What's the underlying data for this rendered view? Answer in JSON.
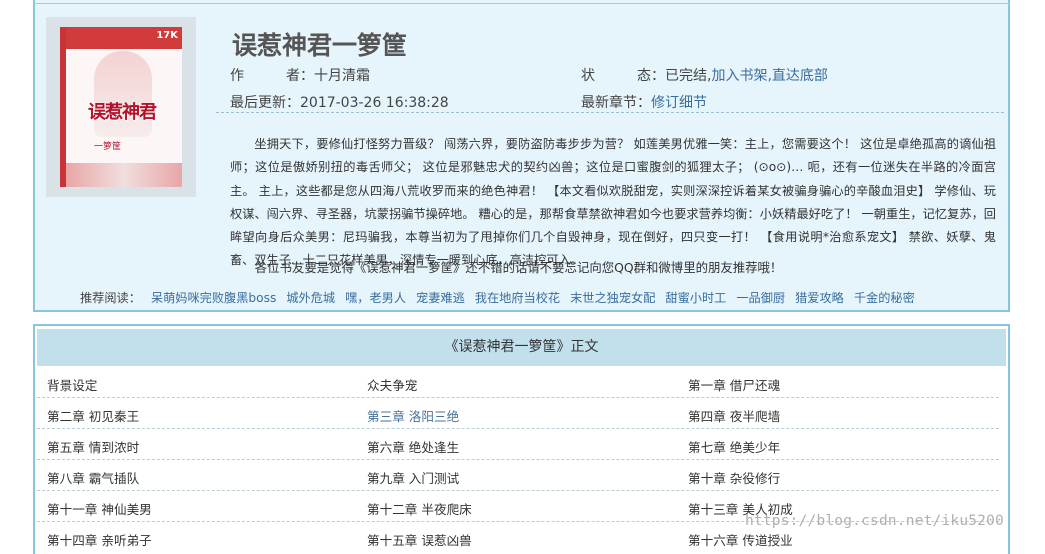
{
  "book": {
    "title": "误惹神君一箩筐",
    "cover_title": "误惹神君",
    "cover_sub": "一箩筐",
    "cover_badge": "17K",
    "author_label": "作　　　者：",
    "author": "十月清霜",
    "status_label": "状　　　态：",
    "status": "已完结,",
    "add_shelf": "加入书架,",
    "goto_bottom": "直达底部",
    "updated_label": "最后更新：",
    "updated": "2017-03-26 16:38:28",
    "latest_label": "最新章节：",
    "latest": "修订细节",
    "intro": "坐拥天下，要修仙打怪努力晋级？ 闯荡六界，要防盗防毒步步为营？ 如莲美男优雅一笑：主上，您需要这个！ 这位是卓绝孤高的谪仙祖师；这位是傲娇别扭的毒舌师父； 这位是邪魅忠犬的契约凶兽；这位是口蜜腹剑的狐狸太子； (⊙o⊙)… 呃，还有一位迷失在半路的冷面宫主。 主上，这些都是您从四海八荒收罗而来的绝色神君！ 【本文看似欢脱甜宠，实则深深控诉着某女被骗身骗心的辛酸血泪史】 学修仙、玩权谋、闯六界、寻圣器，坑蒙拐骗节操碎地。 糟心的是，那帮食草禁欲神君如今也要求营养均衡：小妖精最好吃了！ 一朝重生，记忆复苏，回眸望向身后众美男：尼玛骗我，本尊当初为了甩掉你们几个自毁神身，现在倒好，四只变一打！ 【食用说明*治愈系宠文】 禁欲、妖孽、鬼畜、双生子...十二只花样美男，深情专一暖到心底，高洁控可入。",
    "recommend_text": "各位书友要是觉得《误惹神君一箩筐》还不错的话请不要忘记向您QQ群和微博里的朋友推荐哦！"
  },
  "recommend": {
    "label": "推荐阅读：",
    "links": [
      "呆萌妈咪完败腹黑boss",
      "城外危城",
      "嘿，老男人",
      "宠妻难逃",
      "我在地府当校花",
      "末世之独宠女配",
      "甜蜜小时工",
      "一品御厨",
      "猎爱攻略",
      "千金的秘密"
    ]
  },
  "chapters": {
    "header": "《误惹神君一箩筐》正文",
    "items": [
      "背景设定",
      "众夫争宠",
      "第一章 借尸还魂",
      "第二章 初见秦王",
      "第三章 洛阳三绝",
      "第四章 夜半爬墙",
      "第五章 情到浓时",
      "第六章 绝处逢生",
      "第七章 绝美少年",
      "第八章 霸气插队",
      "第九章 入门测试",
      "第十章 杂役修行",
      "第十一章 神仙美男",
      "第十二章 半夜爬床",
      "第十三章 美人初成",
      "第十四章 亲听弟子",
      "第十五章 误惹凶兽",
      "第十六章 传道授业"
    ]
  },
  "watermark": "https://blog.csdn.net/iku5200",
  "colors": {
    "accent": "#88c5de",
    "link": "#3a6d9c",
    "header_bg": "#c2e0ec",
    "panel_bg": "#e6f5fc"
  }
}
